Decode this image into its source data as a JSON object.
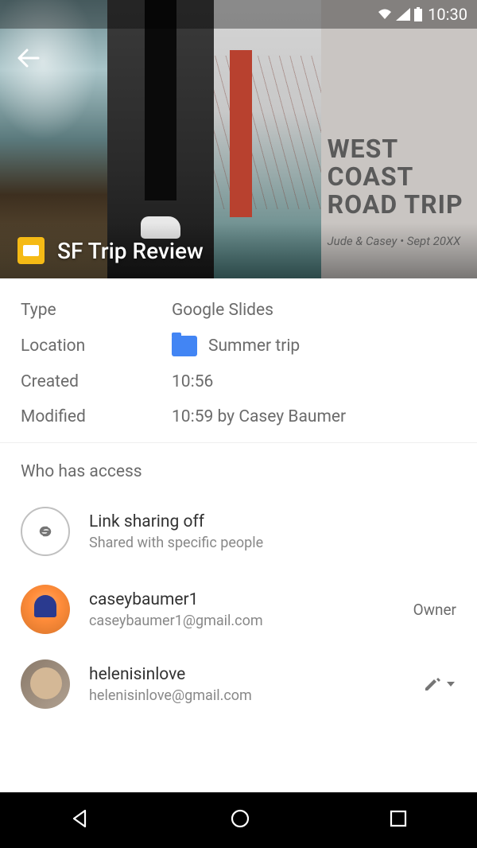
{
  "status": {
    "time": "10:30"
  },
  "header": {
    "file_title": "SF Trip Review",
    "hero_title_line1": "WEST COAST",
    "hero_title_line2": "ROAD TRIP",
    "hero_subtitle": "Jude & Casey • Sept 20XX"
  },
  "details": {
    "labels": {
      "type": "Type",
      "location": "Location",
      "created": "Created",
      "modified": "Modified"
    },
    "type": "Google Slides",
    "location": "Summer trip",
    "created": "10:56",
    "modified": "10:59 by Casey Baumer"
  },
  "access": {
    "section_title": "Who has access",
    "link_title": "Link sharing off",
    "link_subtitle": "Shared with specific people",
    "people": [
      {
        "name": "caseybaumer1",
        "email": "caseybaumer1@gmail.com",
        "role": "Owner"
      },
      {
        "name": "helenisinlove",
        "email": "helenisinlove@gmail.com",
        "role": ""
      }
    ]
  }
}
